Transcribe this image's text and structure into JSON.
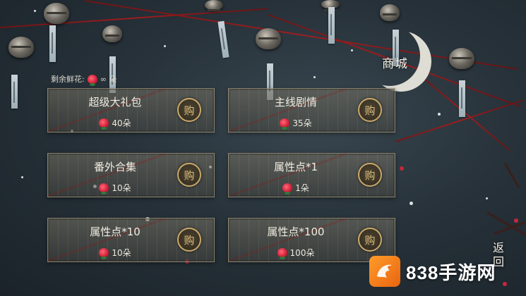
{
  "header": {
    "title": "商城"
  },
  "currency": {
    "label": "剩余鲜花:",
    "value": "∞ 朵",
    "icon": "rose-icon"
  },
  "items": [
    {
      "name": "超级大礼包",
      "price": "40朵",
      "buy_label": "购"
    },
    {
      "name": "主线剧情",
      "price": "35朵",
      "buy_label": "购"
    },
    {
      "name": "番外合集",
      "price": "10朵",
      "buy_label": "购"
    },
    {
      "name": "属性点*1",
      "price": "1朵",
      "buy_label": "购"
    },
    {
      "name": "属性点*10",
      "price": "10朵",
      "buy_label": "购"
    },
    {
      "name": "属性点*100",
      "price": "100朵",
      "buy_label": "购"
    }
  ],
  "nav": {
    "back_label": "返回"
  },
  "watermark": {
    "text": "838手游网",
    "icon": "dragon-icon"
  },
  "colors": {
    "accent_gold": "#c9a86a",
    "rope_red": "#b31a1a",
    "logo_orange": "#ff9c2a"
  }
}
